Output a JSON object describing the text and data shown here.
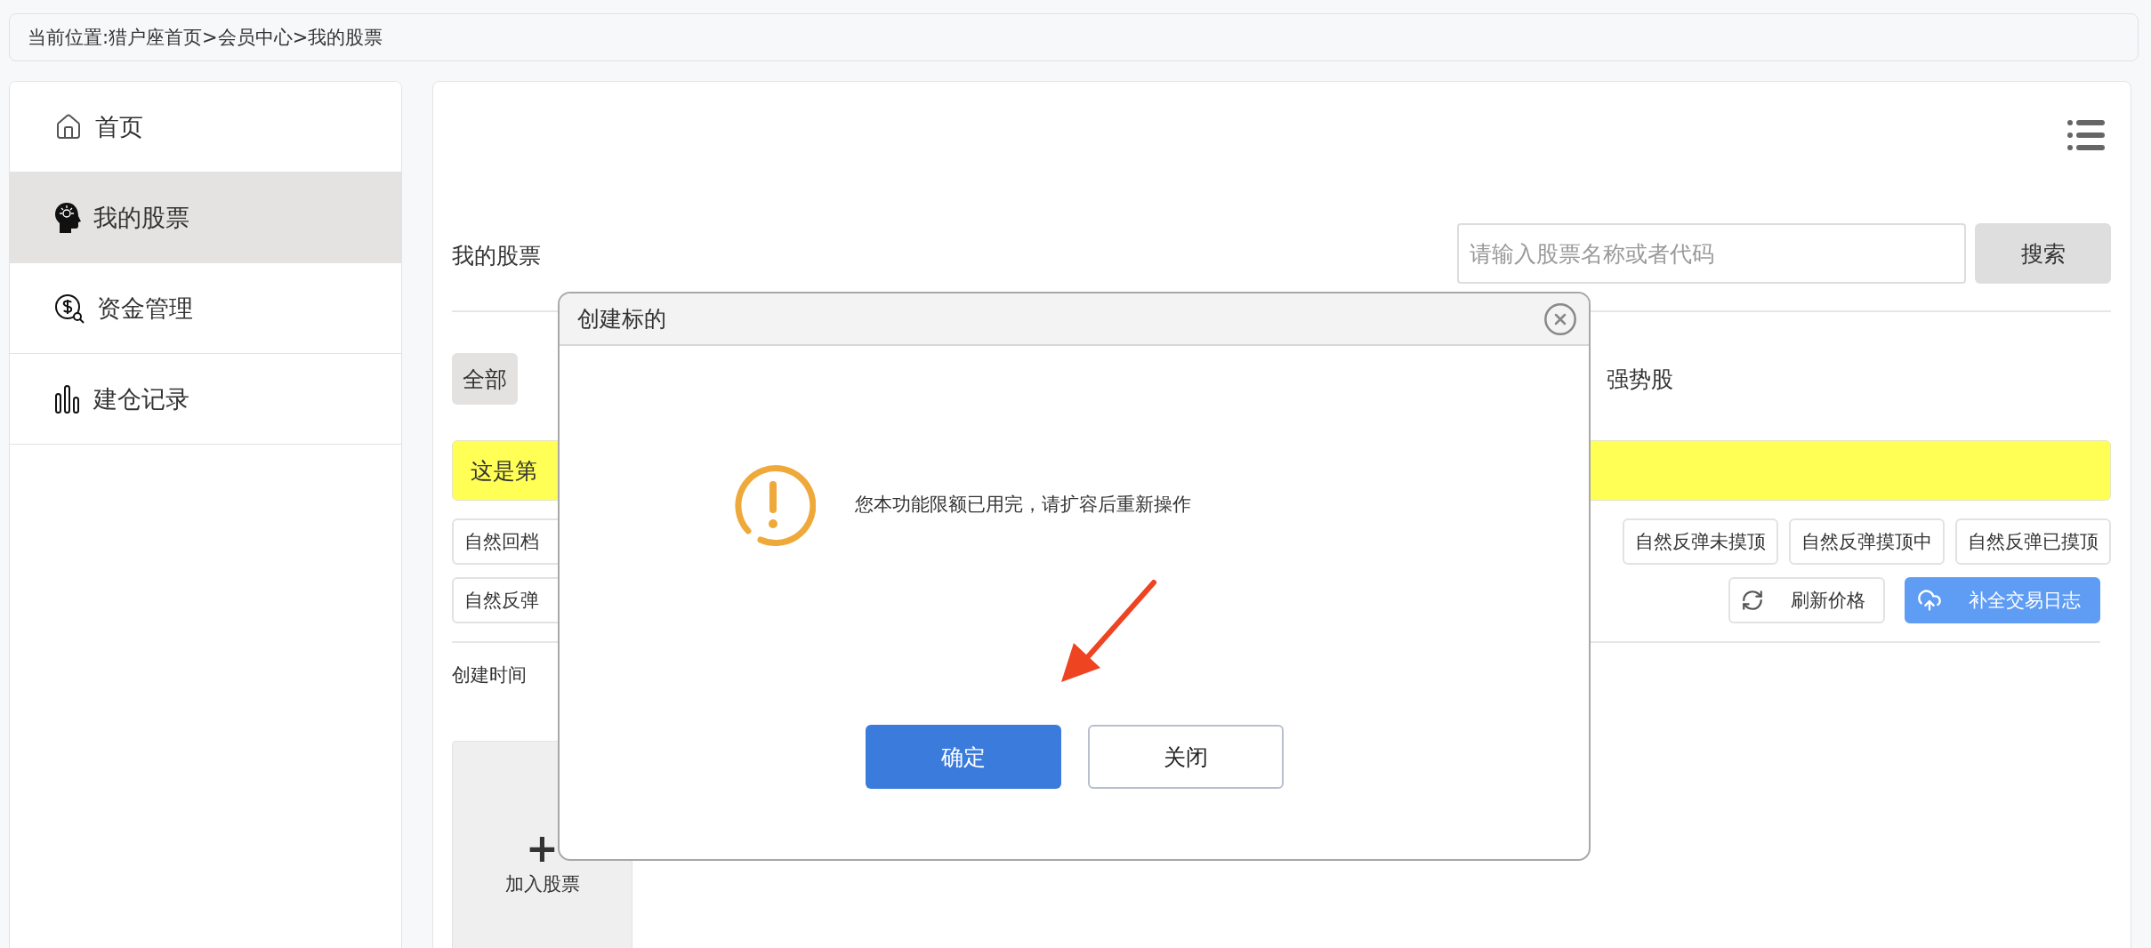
{
  "breadcrumb": "当前位置:猎户座首页>会员中心>我的股票",
  "sidebar": {
    "items": [
      {
        "label": "首页",
        "kind": "home",
        "selected": false
      },
      {
        "label": "我的股票",
        "kind": "head",
        "selected": true
      },
      {
        "label": "资金管理",
        "kind": "money",
        "selected": false
      },
      {
        "label": "建仓记录",
        "kind": "bars",
        "selected": false
      }
    ]
  },
  "main": {
    "title": "我的股票",
    "search": {
      "placeholder": "请输入股票名称或者代码",
      "button": "搜索"
    },
    "tabs": [
      {
        "label": "全部",
        "selected": true
      },
      {
        "label": "强势股",
        "selected": false
      }
    ],
    "notice": "这是第",
    "tags_row_1": {
      "left": [
        "自然回档"
      ],
      "right": [
        "自然反弹未摸顶",
        "自然反弹摸顶中",
        "自然反弹已摸顶"
      ]
    },
    "tags_row_2": {
      "left": [
        "自然反弹"
      ],
      "actions": [
        {
          "label": "刷新价格",
          "kind": "plain"
        },
        {
          "label": "补全交易日志",
          "kind": "primary"
        }
      ]
    },
    "sort_label": "创建时间",
    "add_card": {
      "symbol": "+",
      "label": "加入股票"
    }
  },
  "dialog": {
    "title": "创建标的",
    "message": "您本功能限额已用完，请扩容后重新操作",
    "buttons": [
      {
        "label": "确定",
        "kind": "primary"
      },
      {
        "label": "关闭",
        "kind": "secondary"
      }
    ]
  }
}
